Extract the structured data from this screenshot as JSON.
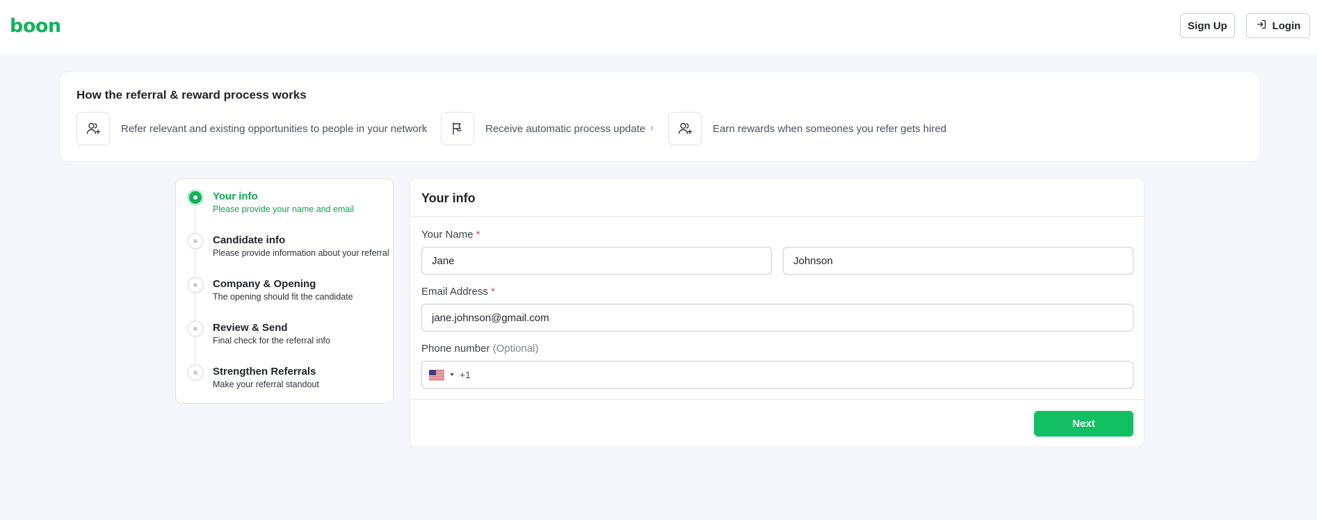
{
  "header": {
    "logo": "boon",
    "signup_label": "Sign Up",
    "login_label": "Login"
  },
  "how_it_works": {
    "title": "How the referral & reward process works",
    "steps": [
      {
        "icon": "user-plus-icon",
        "text": "Refer relevant and existing opportunities to people in your network"
      },
      {
        "icon": "flag-icon",
        "text": "Receive automatic process update"
      },
      {
        "icon": "user-plus-icon",
        "text": "Earn rewards when someones you refer gets hired"
      }
    ]
  },
  "stepper": {
    "steps": [
      {
        "title": "Your info",
        "subtitle": "Please provide your name and email",
        "state": "active"
      },
      {
        "title": "Candidate info",
        "subtitle": "Please provide information about your referral",
        "state": "pending"
      },
      {
        "title": "Company & Opening",
        "subtitle": "The opening should fit the candidate",
        "state": "pending"
      },
      {
        "title": "Review & Send",
        "subtitle": "Final check for the referral info",
        "state": "pending"
      },
      {
        "title": "Strengthen Referrals",
        "subtitle": "Make your referral standout",
        "state": "pending"
      }
    ]
  },
  "form": {
    "title": "Your info",
    "name_label": "Your Name",
    "required_mark": "*",
    "first_name": "Jane",
    "last_name": "Johnson",
    "email_label": "Email Address",
    "email": "jane.johnson@gmail.com",
    "phone_label": "Phone number",
    "phone_optional": "(Optional)",
    "phone_country": "US",
    "phone_dial_code": "+1",
    "phone_value": "",
    "next_label": "Next"
  },
  "colors": {
    "brand_green": "#12b25a",
    "button_green": "#12bf63",
    "required_red": "#e5484d",
    "background": "#f6f7fa"
  }
}
